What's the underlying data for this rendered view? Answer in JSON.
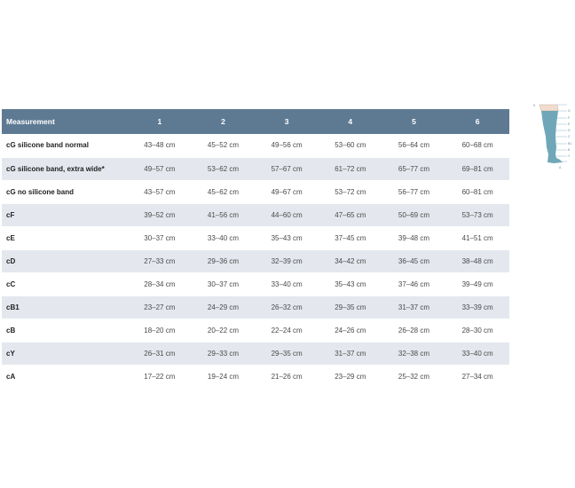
{
  "table": {
    "header": [
      "Measurement",
      "1",
      "2",
      "3",
      "4",
      "5",
      "6"
    ],
    "rows": [
      {
        "label": "cG silicone band normal",
        "values": [
          "43–48 cm",
          "45–52 cm",
          "49–56 cm",
          "53–60 cm",
          "56–64 cm",
          "60–68 cm"
        ]
      },
      {
        "label": "cG silicone band, extra wide*",
        "values": [
          "49–57 cm",
          "53–62 cm",
          "57–67 cm",
          "61–72 cm",
          "65–77 cm",
          "69–81 cm"
        ]
      },
      {
        "label": "cG no silicone band",
        "values": [
          "43–57 cm",
          "45–62 cm",
          "49–67 cm",
          "53–72 cm",
          "56–77 cm",
          "60–81 cm"
        ]
      },
      {
        "label": "cF",
        "values": [
          "39–52 cm",
          "41–56 cm",
          "44–60 cm",
          "47–65 cm",
          "50–69 cm",
          "53–73 cm"
        ]
      },
      {
        "label": "cE",
        "values": [
          "30–37 cm",
          "33–40 cm",
          "35–43 cm",
          "37–45 cm",
          "39–48 cm",
          "41–51 cm"
        ]
      },
      {
        "label": "cD",
        "values": [
          "27–33 cm",
          "29–36 cm",
          "32–39 cm",
          "34–42 cm",
          "36–45 cm",
          "38–48 cm"
        ]
      },
      {
        "label": "cC",
        "values": [
          "28–34 cm",
          "30–37 cm",
          "33–40 cm",
          "35–43 cm",
          "37–46 cm",
          "39–49 cm"
        ]
      },
      {
        "label": "cB1",
        "values": [
          "23–27 cm",
          "24–29 cm",
          "26–32 cm",
          "29–35 cm",
          "31–37 cm",
          "33–39 cm"
        ]
      },
      {
        "label": "cB",
        "values": [
          "18–20 cm",
          "20–22 cm",
          "22–24 cm",
          "24–26 cm",
          "26–28 cm",
          "28–30 cm"
        ]
      },
      {
        "label": "cY",
        "values": [
          "26–31 cm",
          "29–33 cm",
          "29–35 cm",
          "31–37 cm",
          "32–38 cm",
          "33–40 cm"
        ]
      },
      {
        "label": "cA",
        "values": [
          "17–22 cm",
          "19–24 cm",
          "21–26 cm",
          "23–29 cm",
          "25–32 cm",
          "27–34 cm"
        ]
      }
    ]
  },
  "illustration": {
    "icon": "leg-measurement-diagram-icon",
    "point_labels": [
      "K",
      "G",
      "F",
      "E",
      "D",
      "C",
      "B1",
      "B",
      "Y",
      "A"
    ]
  },
  "colors": {
    "header_bg": "#5e7a93",
    "stripe_bg": "#e4e8ee",
    "stocking": "#5f9db1"
  }
}
